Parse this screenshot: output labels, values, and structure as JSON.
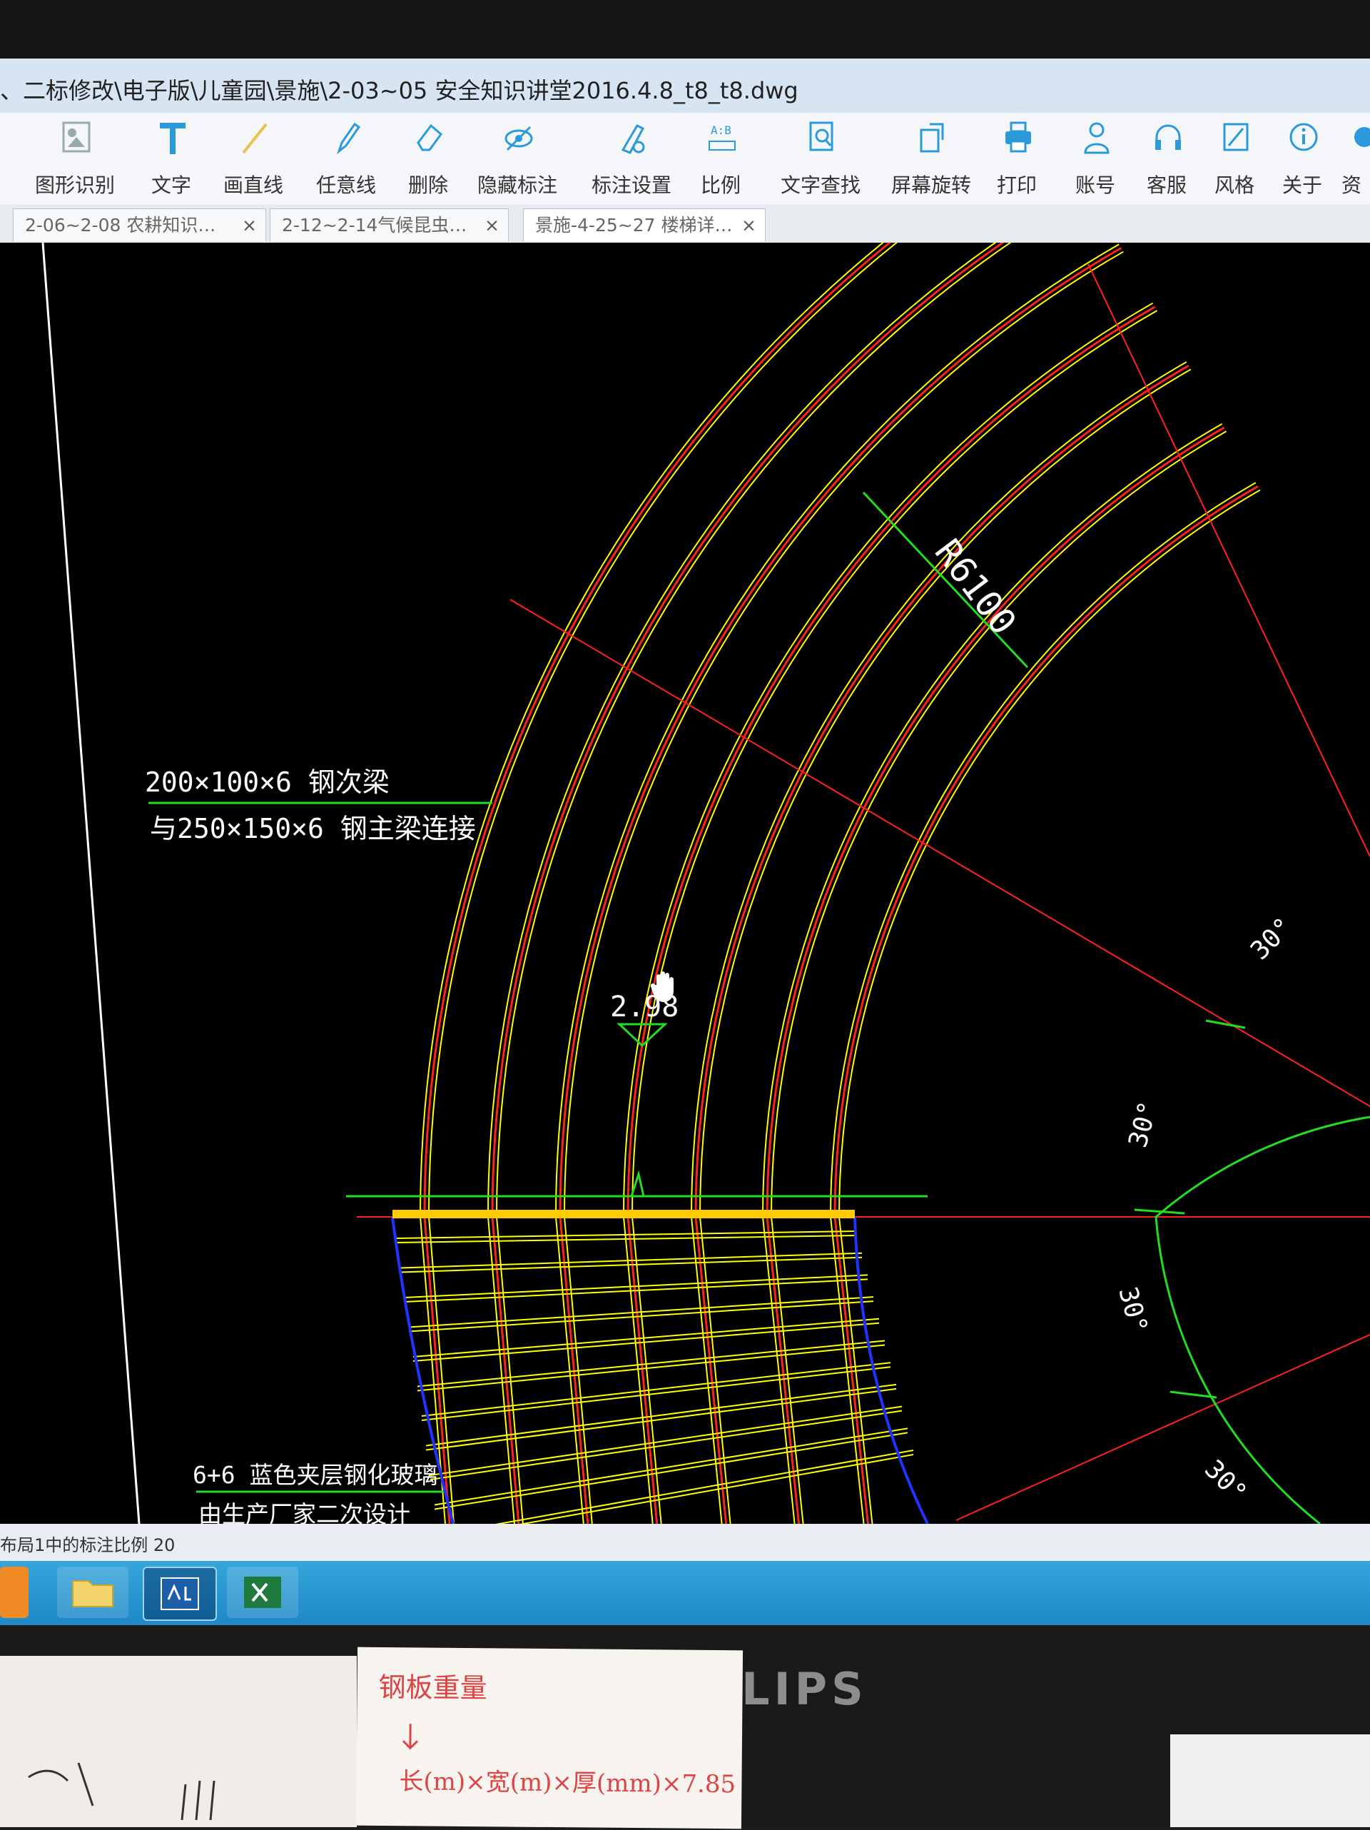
{
  "window": {
    "title": "、二标修改\\电子版\\儿童园\\景施\\2-03~05 安全知识讲堂2016.4.8_t8_t8.dwg"
  },
  "toolbar": {
    "items": [
      {
        "label": "图形识别",
        "icon": "shape-recognize-icon"
      },
      {
        "label": "文字",
        "icon": "text-t-icon"
      },
      {
        "label": "画直线",
        "icon": "line-icon"
      },
      {
        "label": "任意线",
        "icon": "pen-icon"
      },
      {
        "label": "删除",
        "icon": "eraser-icon"
      },
      {
        "label": "隐藏标注",
        "icon": "eye-hide-icon"
      },
      {
        "label": "标注设置",
        "icon": "dimension-settings-icon"
      },
      {
        "label": "比例",
        "icon": "scale-icon"
      },
      {
        "label": "文字查找",
        "icon": "text-search-icon"
      },
      {
        "label": "屏幕旋转",
        "icon": "rotate-screen-icon"
      },
      {
        "label": "打印",
        "icon": "printer-icon"
      },
      {
        "label": "账号",
        "icon": "user-icon"
      },
      {
        "label": "客服",
        "icon": "headset-icon"
      },
      {
        "label": "风格",
        "icon": "style-icon"
      },
      {
        "label": "关于",
        "icon": "info-icon"
      },
      {
        "label": "资",
        "icon": "resource-icon"
      }
    ]
  },
  "tabs": [
    {
      "label": "2-06~2-08 农耕知识…",
      "close": "×"
    },
    {
      "label": "2-12~2-14气候昆虫…",
      "close": "×"
    },
    {
      "label": "景施-4-25~27 楼梯详…",
      "close": "×"
    }
  ],
  "drawing": {
    "radius_label": "R6100",
    "elevation_label": "2.98",
    "angles": [
      "30°",
      "30°",
      "30°",
      "30°"
    ],
    "note1_line1": "200×100×6 钢次梁",
    "note1_line2": "与250×150×6 钢主梁连接",
    "note2_line1": "6+6 蓝色夹层钢化玻璃",
    "note2_line2": "由生产厂家二次设计",
    "colors": {
      "yellow": "#ffff00",
      "red": "#ff2020",
      "green": "#22dd22",
      "blue": "#2233ff",
      "background": "#000000"
    }
  },
  "status": {
    "text": "布局1中的标注比例 20"
  },
  "taskbar": {
    "apps": [
      "media-player-icon",
      "folder-icon",
      "cad-app-icon",
      "excel-icon"
    ]
  },
  "monitor": {
    "brand": "ILIPS"
  },
  "sticky_note": {
    "line1": "钢板重量",
    "line2": "长(m)×宽(m)×厚(mm)×7.85"
  }
}
